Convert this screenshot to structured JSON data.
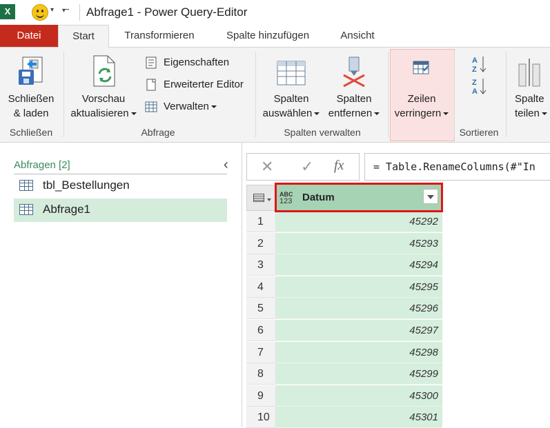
{
  "window": {
    "app_icon_label": "X",
    "title": "Abfrage1 - Power Query-Editor"
  },
  "tabs": [
    {
      "label": "Datei"
    },
    {
      "label": "Start"
    },
    {
      "label": "Transformieren"
    },
    {
      "label": "Spalte hinzufügen"
    },
    {
      "label": "Ansicht"
    }
  ],
  "ribbon": {
    "close_load": {
      "line1": "Schließen",
      "line2": "& laden"
    },
    "group_close": "Schließen",
    "refresh_preview": {
      "line1": "Vorschau",
      "line2": "aktualisieren"
    },
    "properties": "Eigenschaften",
    "advanced_editor": "Erweiterter Editor",
    "manage": "Verwalten",
    "group_query": "Abfrage",
    "choose_columns": {
      "line1": "Spalten",
      "line2": "auswählen"
    },
    "remove_columns": {
      "line1": "Spalten",
      "line2": "entfernen"
    },
    "group_manage_columns": "Spalten verwalten",
    "reduce_rows": {
      "line1": "Zeilen",
      "line2": "verringern"
    },
    "sort_az": "A Z",
    "sort_za": "Z A",
    "group_sort": "Sortieren",
    "split_column": {
      "line1": "Spalte",
      "line2": "teilen"
    }
  },
  "queries_pane": {
    "header": "Abfragen [2]",
    "items": [
      {
        "label": "tbl_Bestellungen",
        "selected": false
      },
      {
        "label": "Abfrage1",
        "selected": true
      }
    ]
  },
  "formula_bar": {
    "cancel_glyph": "✕",
    "confirm_glyph": "✓",
    "fx_glyph": "fx",
    "formula": "= Table.RenameColumns(#\"In"
  },
  "grid": {
    "column": {
      "type_top": "ABC",
      "type_bottom": "123",
      "name": "Datum"
    },
    "rows": [
      {
        "num": "1",
        "value": "45292"
      },
      {
        "num": "2",
        "value": "45293"
      },
      {
        "num": "3",
        "value": "45294"
      },
      {
        "num": "4",
        "value": "45295"
      },
      {
        "num": "5",
        "value": "45296"
      },
      {
        "num": "6",
        "value": "45297"
      },
      {
        "num": "7",
        "value": "45298"
      },
      {
        "num": "8",
        "value": "45299"
      },
      {
        "num": "9",
        "value": "45300"
      },
      {
        "num": "10",
        "value": "45301"
      }
    ]
  },
  "colors": {
    "file_tab": "#c42b1c",
    "selected_query": "#d5ecdc",
    "column_header": "#a6d3b4",
    "cell": "#d6eedd",
    "highlight_outline": "#e01515"
  }
}
